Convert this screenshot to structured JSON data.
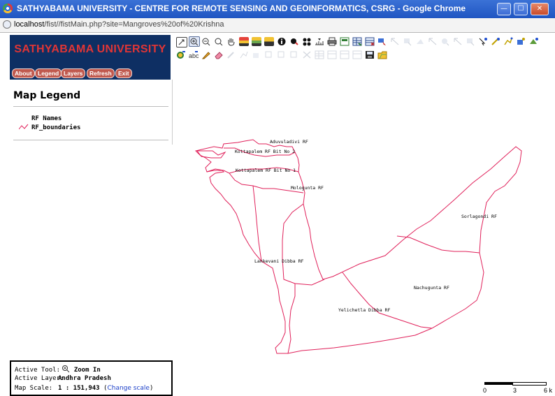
{
  "window": {
    "title": "SATHYABAMA UNIVERSITY - CENTRE FOR REMOTE SENSING AND GEOINFORMATICS, CSRG - Google Chrome",
    "minimize_label": "—",
    "maximize_label": "☐",
    "close_label": "✕"
  },
  "address": {
    "host": "localhost",
    "path": "/fist//fistMain.php?site=Mangroves%20of%20Krishna"
  },
  "header": {
    "university": "SATHYABAMA UNIVERSITY"
  },
  "menu": {
    "about": "About",
    "legend": "Legend",
    "layers": "Layers",
    "refresh": "Refresh",
    "exit": "Exit"
  },
  "legend": {
    "title": "Map Legend",
    "items": [
      "RF Names",
      "RF_boundaries"
    ],
    "line_color": "#e0205a"
  },
  "toolbar": {
    "row1_icons": [
      "zoom-extent-icon",
      "zoom-in-icon",
      "zoom-out-icon",
      "zoom-previous-icon",
      "pan-hand-icon",
      "layer-add-icon",
      "layer-remove-icon",
      "layer-edit-icon",
      "info-icon",
      "query-icon",
      "select-icon",
      "measure-icon",
      "print-icon",
      "export-map-icon",
      "table-icon",
      "report-icon",
      "selection-arrow-icon",
      "select-tool-1-icon",
      "select-tool-2-icon",
      "select-tool-3-icon",
      "select-tool-4-icon",
      "select-tool-5-icon",
      "select-tool-6-icon",
      "select-tool-7-icon",
      "select-tool-8-icon",
      "edit-point-icon",
      "edit-line-icon",
      "edit-poly-icon",
      "edit-vertex-icon"
    ],
    "row2_icons": [
      "digitize-icon",
      "label-icon",
      "draw-icon",
      "eraser-icon",
      "edit-disabled-1-icon",
      "edit-disabled-2-icon",
      "edit-disabled-3-icon",
      "edit-disabled-4-icon",
      "edit-disabled-5-icon",
      "edit-disabled-6-icon",
      "delete-icon",
      "grid-icon",
      "edit-disabled-7-icon",
      "edit-disabled-8-icon",
      "edit-disabled-9-icon",
      "save-icon",
      "open-folder-icon"
    ]
  },
  "map": {
    "boundary_color": "#e0205a",
    "labels": [
      "Aduvuladivi RF",
      "Kottapalem RF Bit No 2",
      "Kottapalem RF Bit No 1",
      "Mologunta RF",
      "Sorlagondi RF",
      "Lankevani Dibba RF",
      "Nachugunta RF",
      "Yelichetla Dibba RF"
    ]
  },
  "status": {
    "active_tool_label": "Active Tool:",
    "active_tool_value": "Zoom In",
    "active_layer_label": "Active Layer:",
    "active_layer_value": "Andhra Pradesh",
    "map_scale_label": "Map Scale:",
    "map_scale_value": "1 : 151,943",
    "change_scale_label": "Change scale"
  },
  "scalebar": {
    "ticks": [
      "0",
      "3",
      "6 k"
    ]
  }
}
